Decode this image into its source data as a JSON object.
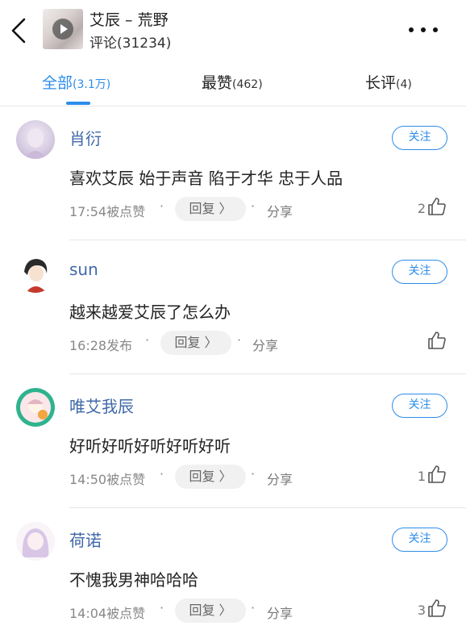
{
  "header": {
    "back_icon": "chevron-left-icon",
    "song_title": "艾辰 – 荒野",
    "comment_count": "评论(31234)",
    "more_icon": "more-dots-icon"
  },
  "tabs": [
    {
      "label": "全部",
      "count": "(3.1万)",
      "active": true
    },
    {
      "label": "最赞",
      "count": "(462)",
      "active": false
    },
    {
      "label": "长评",
      "count": "(4)",
      "active": false
    }
  ],
  "colors": {
    "accent": "#2d8dea",
    "username": "#3f68a8",
    "meta": "#888888"
  },
  "comments": [
    {
      "username": "肖衍",
      "follow": "关注",
      "content": "喜欢艾辰 始于声音 陷于才华 忠于人品",
      "time": "17:54被点赞",
      "reply": "回复 〉",
      "share": "分享",
      "likes": "2"
    },
    {
      "username": "sun",
      "follow": "关注",
      "content": "越来越爱艾辰了怎么办",
      "time": "16:28发布",
      "reply": "回复 〉",
      "share": "分享",
      "likes": ""
    },
    {
      "username": "唯艾我辰",
      "follow": "关注",
      "content": "好听好听好听好听好听",
      "time": "14:50被点赞",
      "reply": "回复 〉",
      "share": "分享",
      "likes": "1"
    },
    {
      "username": "荷诺",
      "follow": "关注",
      "content": "不愧我男神哈哈哈",
      "time": "14:04被点赞",
      "reply": "回复 〉",
      "share": "分享",
      "likes": "3"
    }
  ]
}
